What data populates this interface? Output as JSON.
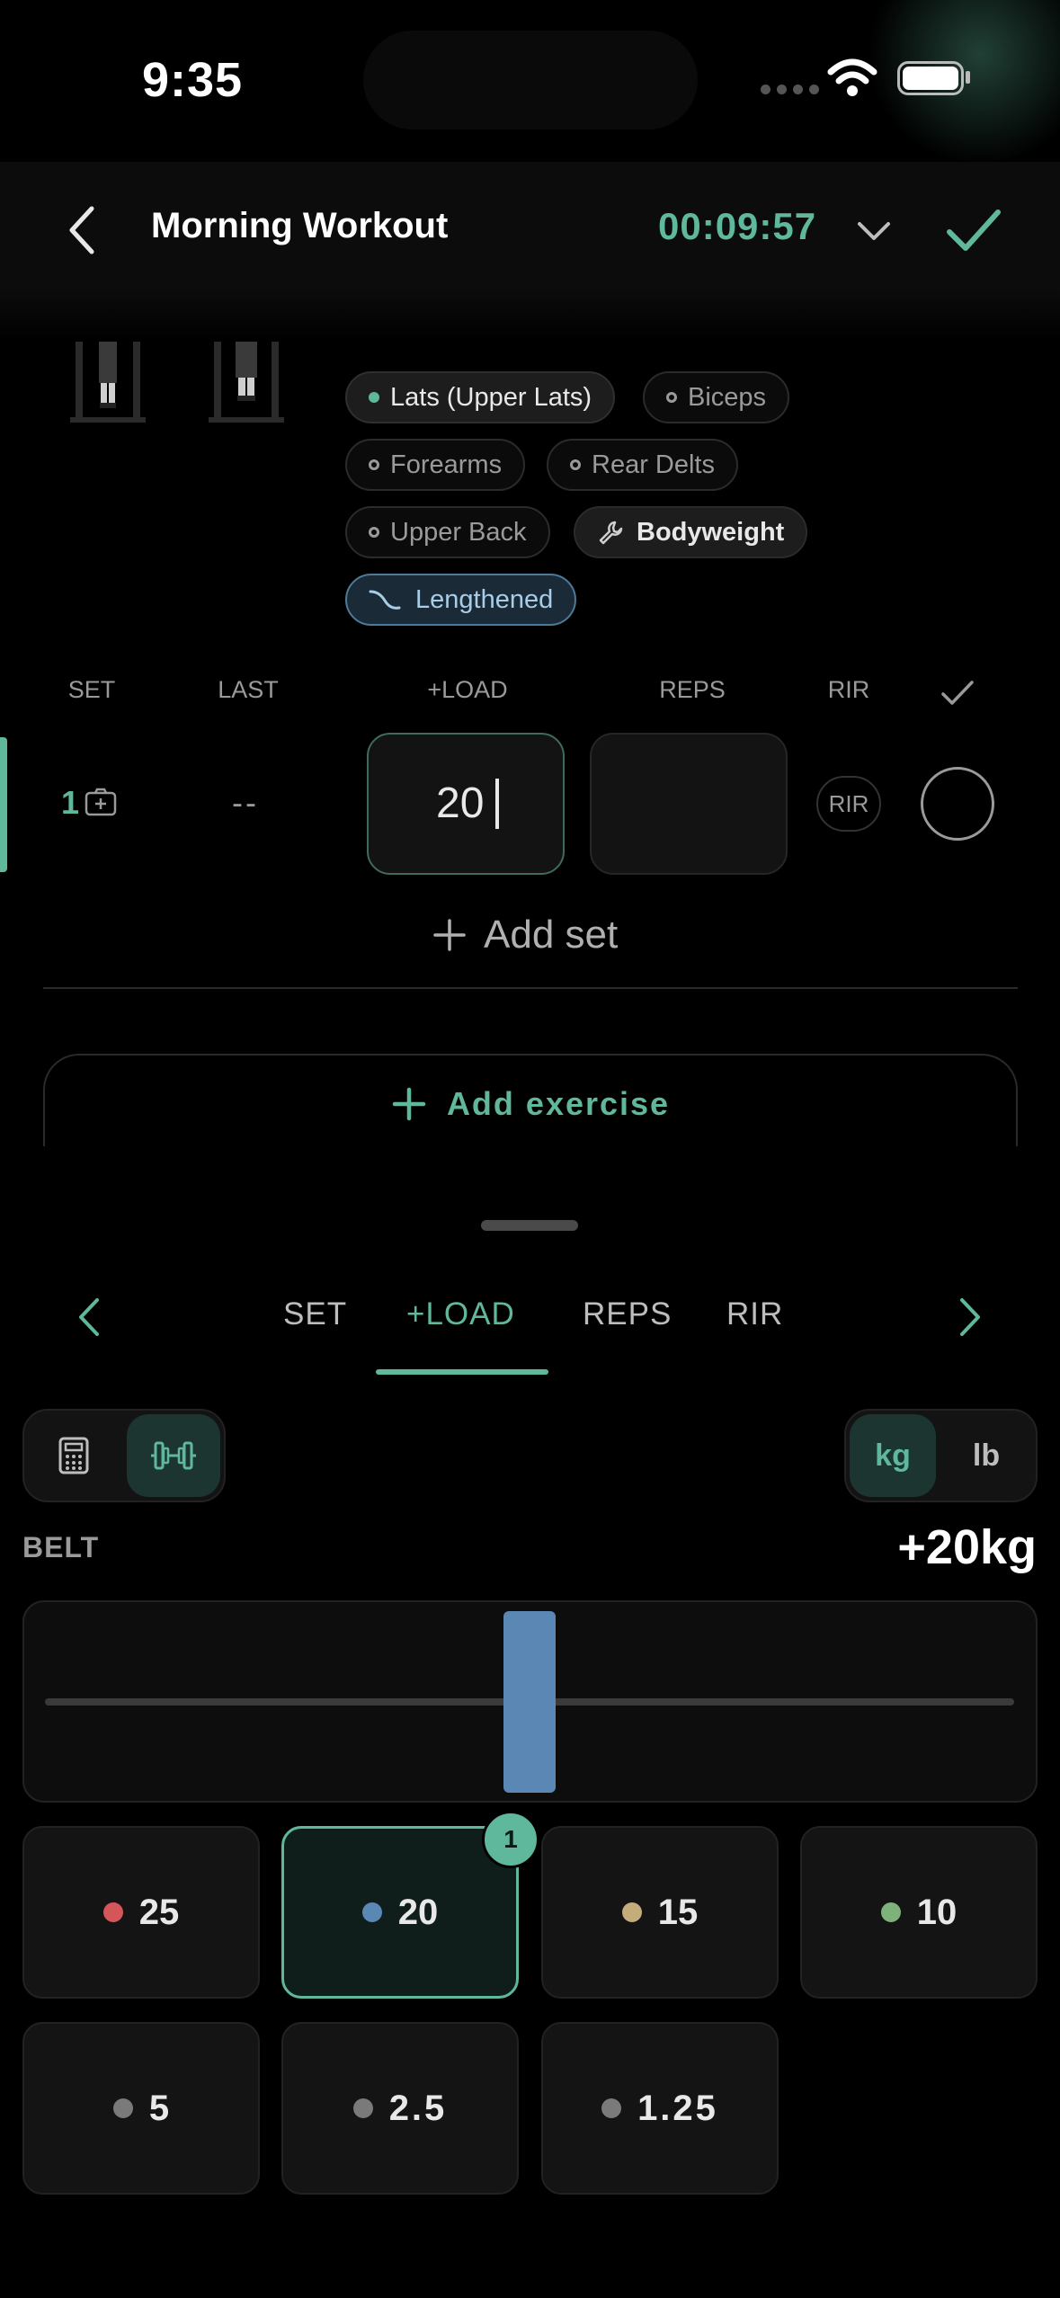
{
  "status_bar": {
    "time": "9:35"
  },
  "header": {
    "title": "Morning Workout",
    "timer": "00:09:57"
  },
  "muscle_tags": [
    {
      "label": "Lats (Upper Lats)",
      "kind": "primary"
    },
    {
      "label": "Biceps",
      "kind": "secondary"
    },
    {
      "label": "Forearms",
      "kind": "secondary"
    },
    {
      "label": "Rear Delts",
      "kind": "secondary"
    },
    {
      "label": "Upper Back",
      "kind": "secondary"
    },
    {
      "label": "Bodyweight",
      "kind": "equipment",
      "icon": "wrench-icon"
    },
    {
      "label": "Lengthened",
      "kind": "lengthened",
      "icon": "curve-icon"
    }
  ],
  "set_table": {
    "headers": {
      "set": "SET",
      "last": "LAST",
      "load": "+LOAD",
      "reps": "REPS",
      "rir": "RIR"
    },
    "rows": [
      {
        "set": "1",
        "last": "--",
        "load": "20",
        "reps": "",
        "rir": "RIR",
        "done": false
      }
    ],
    "add_set_label": "Add set"
  },
  "add_exercise_label": "Add exercise",
  "keypad": {
    "tabs": [
      "SET",
      "+LOAD",
      "REPS",
      "RIR"
    ],
    "active_tab": "+LOAD",
    "mode_icons": [
      "calculator-icon",
      "dumbbell-icon"
    ],
    "active_mode": "dumbbell-icon",
    "units": [
      "kg",
      "lb"
    ],
    "active_unit": "kg",
    "equipment_label": "BELT",
    "total_label": "+20kg",
    "plates": [
      {
        "value": "25",
        "color": "#d4565a"
      },
      {
        "value": "20",
        "color": "#5a87b4",
        "count": "1",
        "selected": true
      },
      {
        "value": "15",
        "color": "#c4ad7a"
      },
      {
        "value": "10",
        "color": "#7fb27a"
      },
      {
        "value": "5",
        "color": "#7a7a7a"
      },
      {
        "value": "2.5",
        "color": "#7a7a7a"
      },
      {
        "value": "1.25",
        "color": "#7a7a7a"
      }
    ],
    "loaded_plate_color": "#5a87b4"
  },
  "accent_color": "#5fb79c"
}
